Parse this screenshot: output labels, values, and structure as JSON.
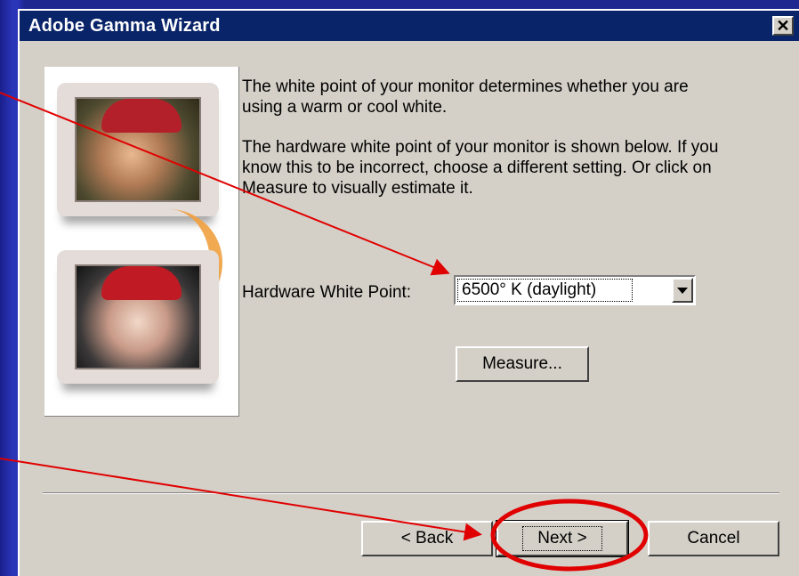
{
  "window": {
    "title": "Adobe Gamma Wizard",
    "close_glyph": "✕"
  },
  "body": {
    "paragraph1": "The white point of your monitor determines whether you are using a warm or cool white.",
    "paragraph2": "The hardware white point of your monitor is shown below. If you know this to be incorrect, choose a different setting. Or click on Measure to visually estimate it."
  },
  "white_point": {
    "label": "Hardware White Point:",
    "selected": "6500° K (daylight)"
  },
  "buttons": {
    "measure": "Measure...",
    "back": "< Back",
    "next": "Next >",
    "cancel": "Cancel"
  },
  "colors": {
    "title_bar": "#0a246a",
    "dialog_bg": "#d4d0c8",
    "annotation_red": "#e00000",
    "illustration_arrow": "#f0a040"
  },
  "icons": {
    "close": "close-icon",
    "dropdown": "chevron-down-icon"
  }
}
